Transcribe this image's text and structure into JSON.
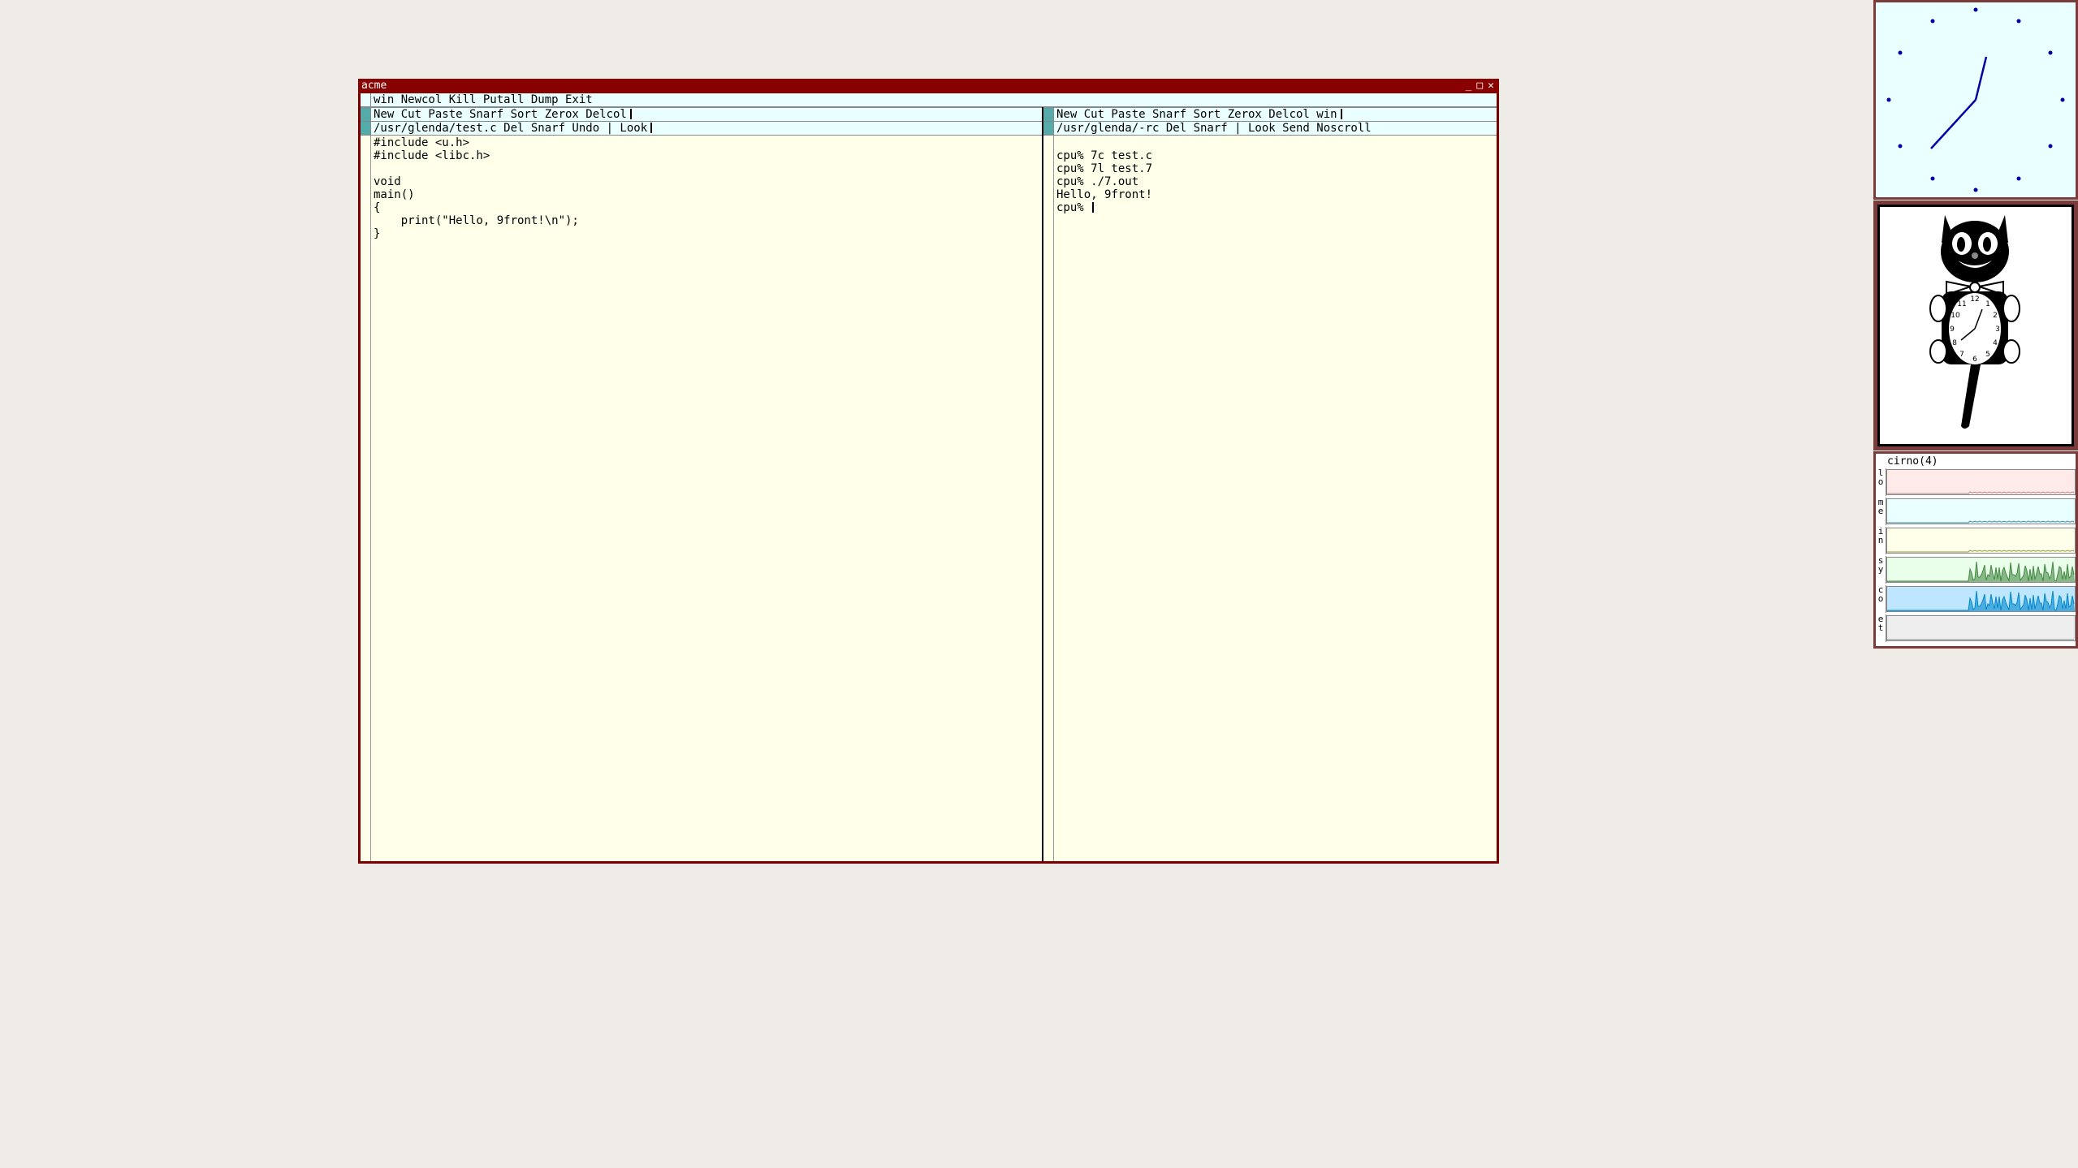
{
  "acme": {
    "title": "acme",
    "window_buttons": [
      "_",
      "□",
      "✕"
    ],
    "main_tag": "win Newcol Kill Putall Dump Exit",
    "left_column": {
      "column_tag": "New Cut Paste Snarf Sort Zerox Delcol",
      "window_tag": "/usr/glenda/test.c Del Snarf Undo | Look",
      "body": "#include <u.h>\n#include <libc.h>\n\nvoid\nmain()\n{\n    print(\"Hello, 9front!\\n\");\n}"
    },
    "right_column": {
      "column_tag": "New Cut Paste Snarf Sort Zerox Delcol win",
      "window_tag": "/usr/glenda/-rc Del Snarf | Look Send Noscroll",
      "body": "\ncpu% 7c test.c\ncpu% 7l test.7\ncpu% ./7.out\nHello, 9front!\ncpu% "
    }
  },
  "stats": {
    "title": "cirno(4)",
    "rows": [
      {
        "label": "lo",
        "color": "#ffeaea",
        "line": "#bb8888"
      },
      {
        "label": "me",
        "color": "#eaffff",
        "line": "#4488aa"
      },
      {
        "label": "in",
        "color": "#ffffea",
        "line": "#99994c"
      },
      {
        "label": "sy",
        "color": "#eaffea",
        "line": "#448844"
      },
      {
        "label": "co",
        "color": "#bfe6ff",
        "line": "#0088cc"
      },
      {
        "label": "et",
        "color": "#eeeeee",
        "line": "#888888"
      }
    ]
  },
  "colors": {
    "desktop": "#efebe6",
    "acme_border": "#880000",
    "acme_body": "#ffffea",
    "acme_tag": "#eaffff",
    "clock_hands": "#0000aa"
  }
}
